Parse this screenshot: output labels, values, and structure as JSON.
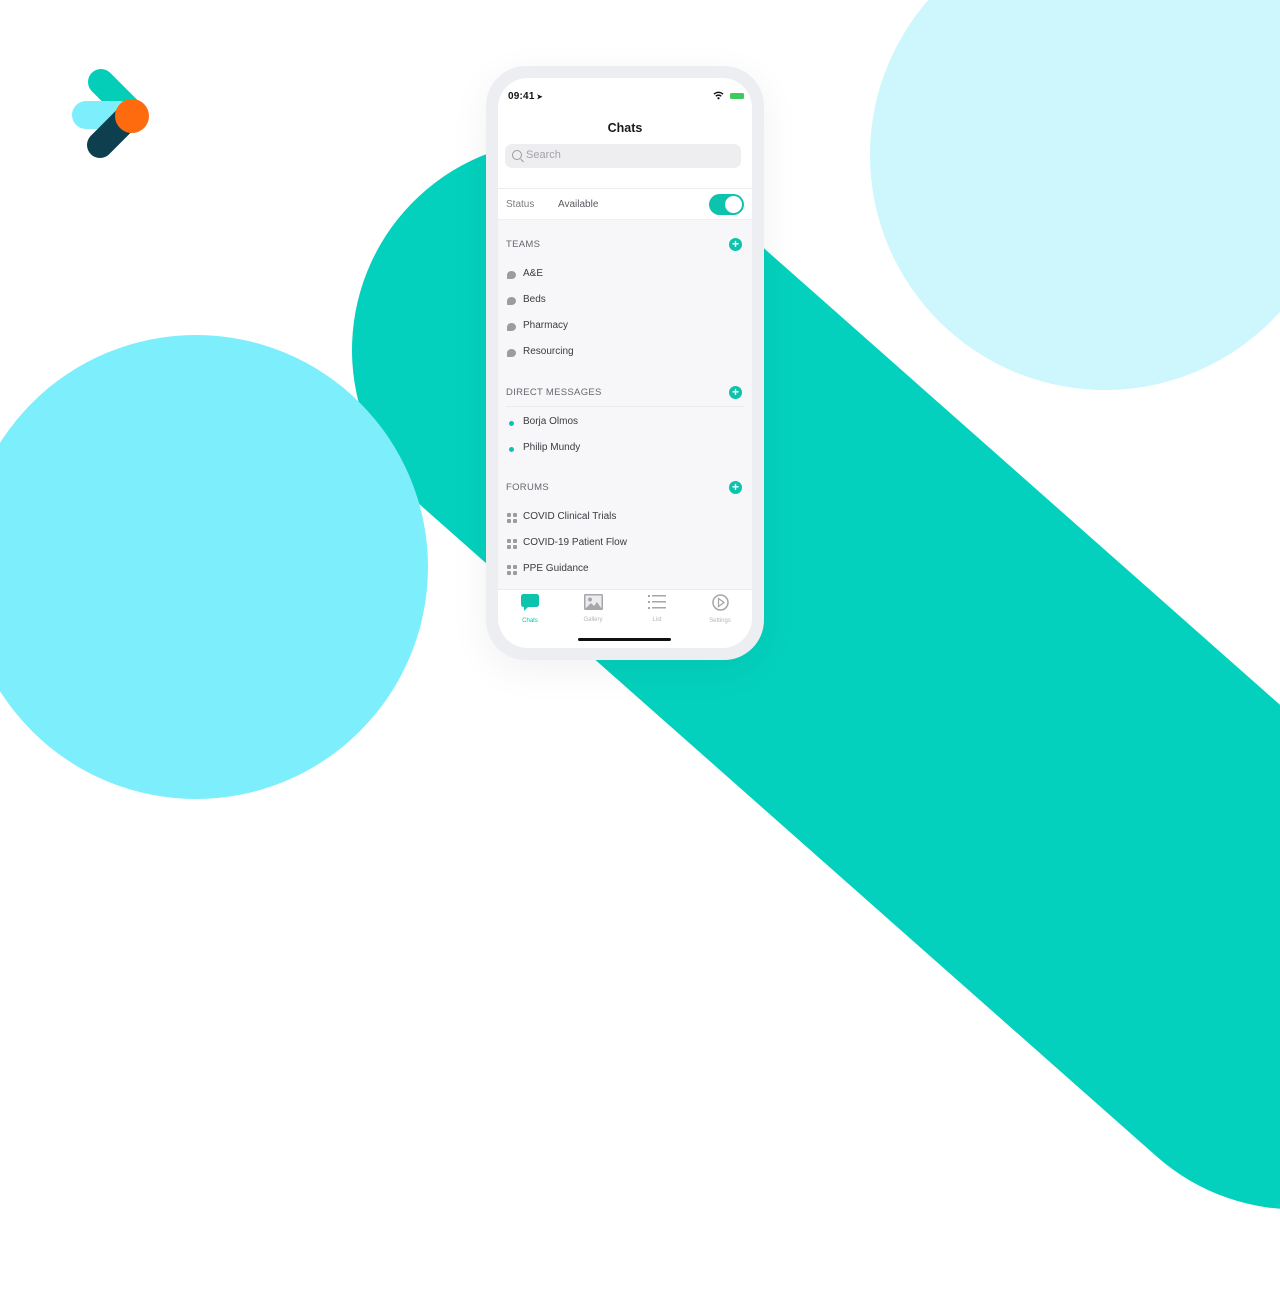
{
  "colors": {
    "brand_teal": "#04d1bd",
    "accent": "#0dc3ad",
    "cyan": "#7deefb",
    "light_cyan": "#cdf7fc",
    "logo_orange": "#fe6b0e",
    "logo_navy": "#0d3f4f"
  },
  "status_bar": {
    "time": "09:41",
    "location_icon": "location-arrow-icon",
    "wifi_icon": "wifi-icon",
    "battery_icon": "battery-icon"
  },
  "header": {
    "title": "Chats",
    "search_placeholder": "Search"
  },
  "status": {
    "label": "Status",
    "value": "Available",
    "toggle_on": true
  },
  "sections": {
    "teams": {
      "title": "TEAMS",
      "items": [
        "A&E",
        "Beds",
        "Pharmacy",
        "Resourcing"
      ]
    },
    "direct_messages": {
      "title": "DIRECT MESSAGES",
      "items": [
        "Borja Olmos",
        "Philip Mundy"
      ]
    },
    "forums": {
      "title": "FORUMS",
      "items": [
        "COVID Clinical Trials",
        "COVID-19 Patient Flow",
        "PPE Guidance"
      ]
    }
  },
  "tabbar": {
    "tabs": [
      {
        "label": "Chats",
        "icon": "chat-bubble-icon",
        "active": true
      },
      {
        "label": "Gallery",
        "icon": "image-icon",
        "active": false
      },
      {
        "label": "List",
        "icon": "list-icon",
        "active": false
      },
      {
        "label": "Settings",
        "icon": "play-circle-icon",
        "active": false
      }
    ]
  }
}
